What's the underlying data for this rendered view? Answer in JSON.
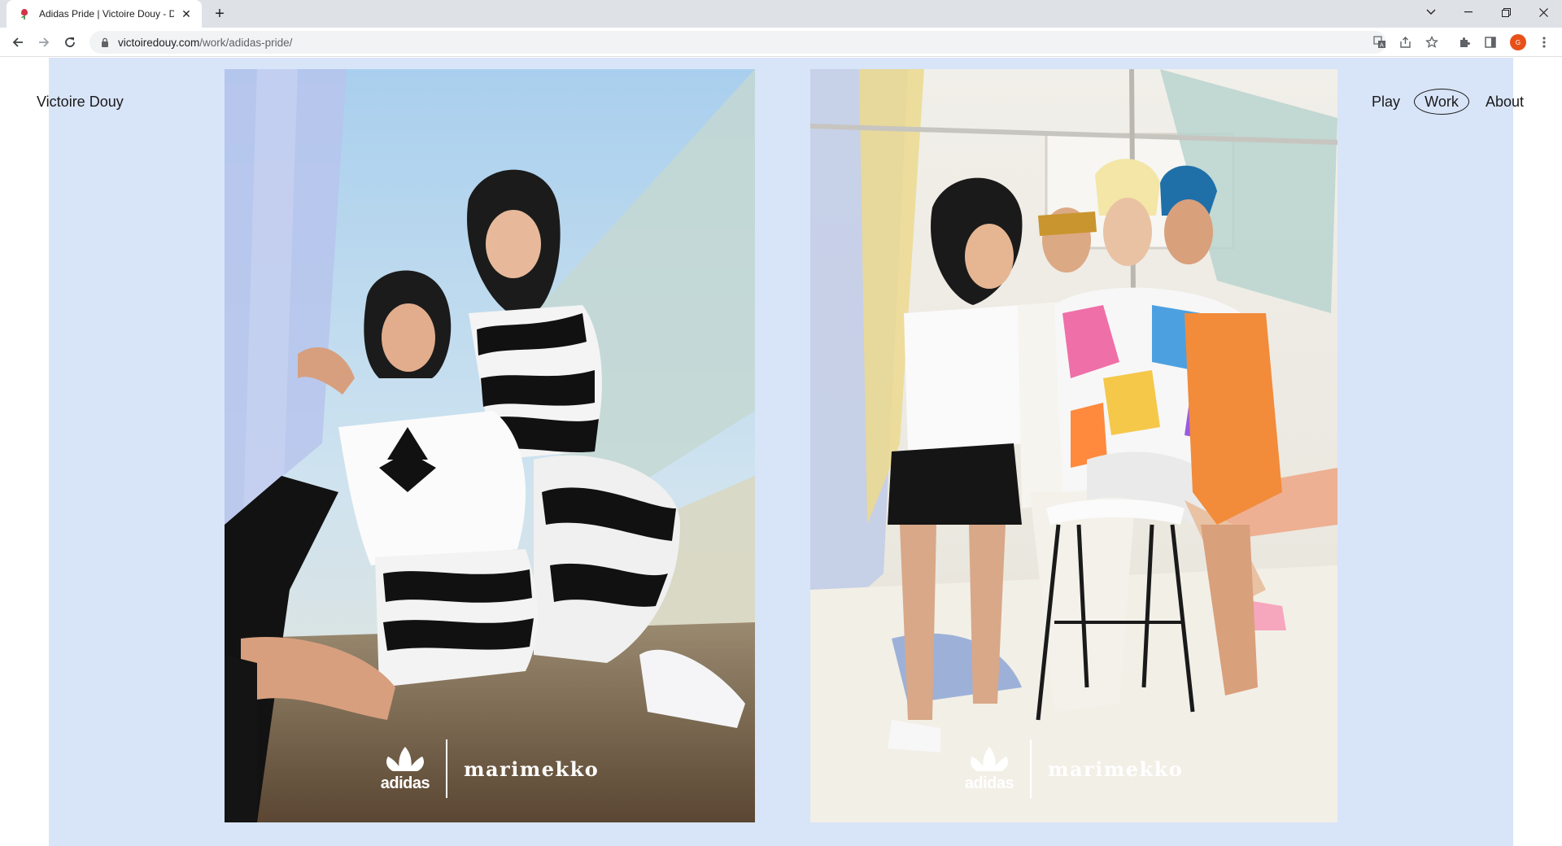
{
  "browser": {
    "tab_title": "Adidas Pride | Victoire Douy - Des",
    "url_host": "victoiredouy.com",
    "url_path": "/work/adidas-pride/",
    "profile_initial": "G"
  },
  "site": {
    "name": "Victoire Douy",
    "nav": {
      "play": "Play",
      "work": "Work",
      "about": "About"
    },
    "panel_color": "#d8e4f8"
  },
  "photos": [
    {
      "subject": "two models in adidas x marimekko outfits on rooftop",
      "brand_left": "adidas",
      "brand_right": "marimekko"
    },
    {
      "subject": "four models in colorful adidas x marimekko outfits in studio",
      "brand_left": "adidas",
      "brand_right": "marimekko"
    }
  ]
}
